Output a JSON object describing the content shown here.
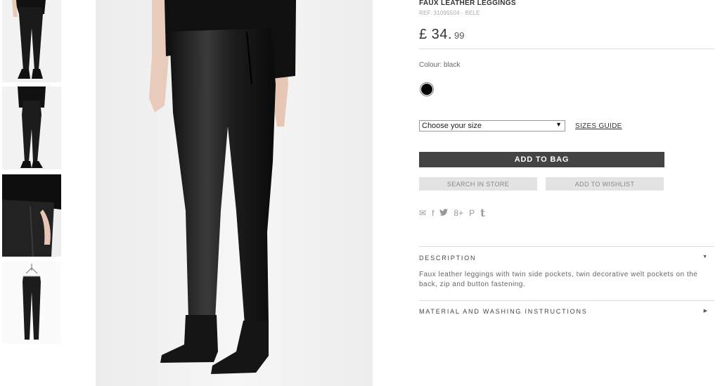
{
  "product": {
    "title": "FAUX LEATHER LEGGINGS",
    "ref": "REF. 31095504 - BELE",
    "price_main": "£ 34.",
    "price_cents": "99",
    "colour_label": "Colour: black",
    "swatch_color": "#000000"
  },
  "size": {
    "selected": "Choose your size",
    "arrow": "▼",
    "guide_label": "SIZES GUIDE"
  },
  "actions": {
    "add_to_bag": "ADD TO BAG",
    "search_in_store": "SEARCH IN STORE",
    "add_to_wishlist": "ADD TO WISHLIST"
  },
  "share": {
    "icons": [
      "email-icon",
      "facebook-icon",
      "twitter-icon",
      "google-plus-icon",
      "pinterest-icon",
      "tumblr-icon"
    ],
    "email": "✉",
    "facebook": "f",
    "twitter": "🐦",
    "gplus": "8+",
    "pinterest": "P",
    "tumblr": "t"
  },
  "sections": {
    "description_title": "DESCRIPTION",
    "description_caret": "▼",
    "description_text": "Faux leather leggings with twin side pockets, twin decorative welt pockets on the back, zip and button fastening.",
    "material_title": "MATERIAL AND WASHING INSTRUCTIONS",
    "material_caret": "▶"
  },
  "colors": {
    "button_dark": "#444444",
    "button_grey": "#e3e3e3",
    "divider": "#dcdcdc"
  }
}
